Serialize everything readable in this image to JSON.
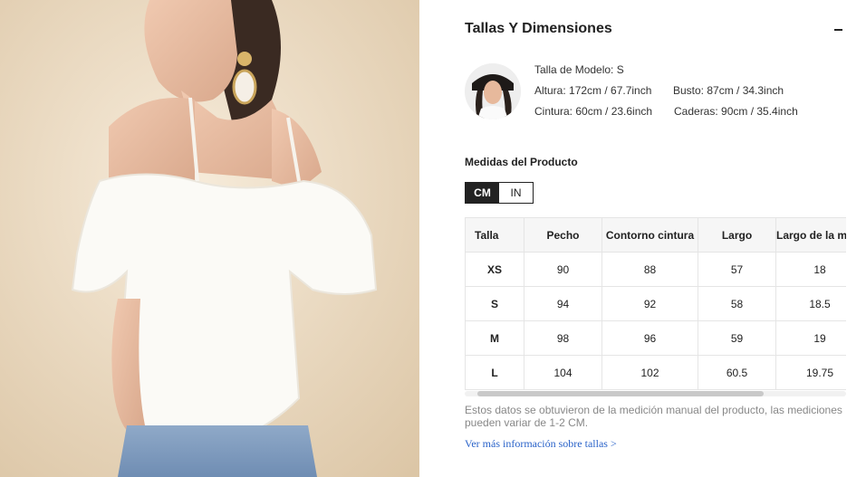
{
  "section": {
    "title": "Tallas Y Dimensiones",
    "collapse_symbol": "−"
  },
  "model": {
    "size": "Talla de Modelo: S",
    "height": "Altura: 172cm / 67.7inch",
    "bust": "Busto: 87cm / 34.3inch",
    "waist": "Cintura: 60cm / 23.6inch",
    "hips": "Caderas: 90cm / 35.4inch"
  },
  "measurements": {
    "title": "Medidas del Producto",
    "units": {
      "cm": "CM",
      "in": "IN",
      "selected": "CM"
    },
    "headers": [
      "Talla",
      "Pecho",
      "Contorno cintura",
      "Largo",
      "Largo de la manga"
    ],
    "rows": [
      [
        "XS",
        "90",
        "88",
        "57",
        "18"
      ],
      [
        "S",
        "94",
        "92",
        "58",
        "18.5"
      ],
      [
        "M",
        "98",
        "96",
        "59",
        "19"
      ],
      [
        "L",
        "104",
        "102",
        "60.5",
        "19.75"
      ]
    ]
  },
  "note": "Estos datos se obtuvieron de la medición manual del producto, las mediciones pueden variar de 1-2 CM.",
  "more_link": "Ver más información sobre tallas >",
  "icons": {
    "collapse": "minus-icon"
  },
  "colors": {
    "text": "#222222",
    "muted": "#888888",
    "link": "#2a63c9",
    "toggle_active": "#222222"
  }
}
